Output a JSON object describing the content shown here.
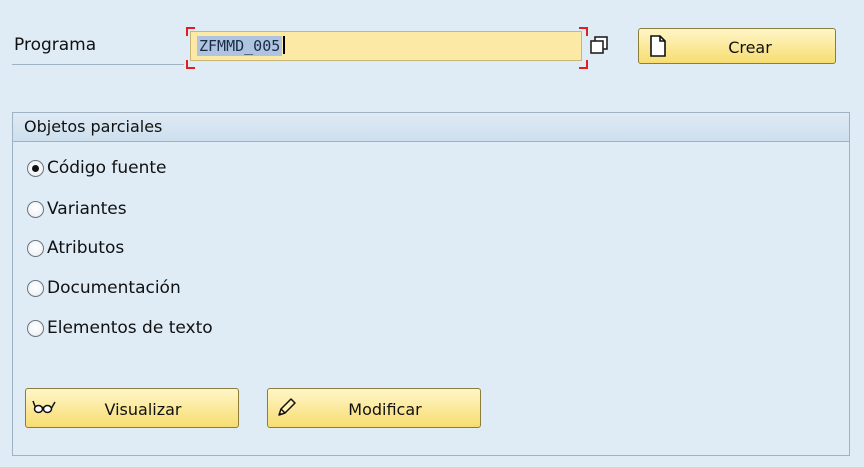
{
  "header": {
    "program_label": "Programa",
    "program_value": "ZFMMD_005",
    "matchcode_icon": "copy-icon",
    "create_label": "Crear",
    "create_icon": "new-document-icon"
  },
  "subobjects": {
    "title": "Objetos parciales",
    "options": [
      {
        "label": "Código fuente",
        "selected": true
      },
      {
        "label": "Variantes",
        "selected": false
      },
      {
        "label": "Atributos",
        "selected": false
      },
      {
        "label": "Documentación",
        "selected": false
      },
      {
        "label": "Elementos de texto",
        "selected": false
      }
    ]
  },
  "actions": {
    "display_label": "Visualizar",
    "display_icon": "glasses-icon",
    "change_label": "Modificar",
    "change_icon": "pencil-icon"
  },
  "colors": {
    "background": "#dfebf5",
    "input_fill": "#fde9a6",
    "button_fill": "#f7dd70",
    "focus_bracket": "#e02020"
  }
}
